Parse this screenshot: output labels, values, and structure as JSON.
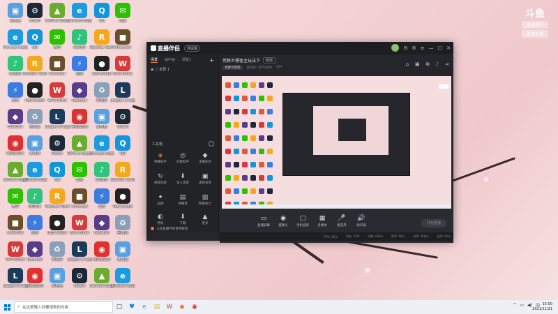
{
  "watermark": {
    "logo": "斗鱼",
    "line1": "直播伴侣",
    "line2": "录制工具"
  },
  "desktop_icons": [
    {
      "label": "此电脑",
      "color": "#5aa0e0",
      "glyph": "▣"
    },
    {
      "label": "Microsoft Edge",
      "color": "#1d9be0",
      "glyph": "e"
    },
    {
      "label": "QQ音乐",
      "color": "#31c27c",
      "glyph": "♪"
    },
    {
      "label": "迅雷",
      "color": "#3b7ce0",
      "glyph": "⚡"
    },
    {
      "label": "Obsidian",
      "color": "#5a3d8a",
      "glyph": "◆"
    },
    {
      "label": "网易云音乐",
      "color": "#e03030",
      "glyph": "◉"
    },
    {
      "label": "GeForce Experience",
      "color": "#6aad2e",
      "glyph": "▲"
    },
    {
      "label": "微信",
      "color": "#2dc100",
      "glyph": "✉"
    },
    {
      "label": "Minecraft",
      "color": "#6b4e2a",
      "glyph": "■"
    },
    {
      "label": "WPS Office",
      "color": "#d63a3a",
      "glyph": "W"
    },
    {
      "label": "League of Legends",
      "color": "#1c3a5a",
      "glyph": "L"
    },
    {
      "label": "Steam",
      "color": "#1b2838",
      "glyph": "⚙"
    },
    {
      "label": "QQ",
      "color": "#1296db",
      "glyph": "Q"
    },
    {
      "label": "Rockstar Games",
      "color": "#f6a81d",
      "glyph": "R"
    },
    {
      "label": "OBS Studio",
      "color": "#222222",
      "glyph": "●"
    },
    {
      "label": "回收站",
      "color": "#8aa0b8",
      "glyph": "♻"
    }
  ],
  "app": {
    "title": "直播伴侣",
    "version_tag": "测试版",
    "left_tabs": [
      "场景",
      "画中画",
      "场景1"
    ],
    "scene_item": "全屏 1",
    "tools_title": "工具箱",
    "tools": [
      {
        "icon": "◈",
        "label": "弹幕助手"
      },
      {
        "icon": "◎",
        "label": "房管助手"
      },
      {
        "icon": "◆",
        "label": "主播任务"
      },
      {
        "icon": "↻",
        "label": "视频连麦"
      },
      {
        "icon": "⬇",
        "label": "多人连麦"
      },
      {
        "icon": "▣",
        "label": "虚拟背景"
      },
      {
        "icon": "✦",
        "label": "美颜"
      },
      {
        "icon": "▤",
        "label": "弹幕墙"
      },
      {
        "icon": "▥",
        "label": "数据统计"
      },
      {
        "icon": "◐",
        "label": "特效"
      },
      {
        "icon": "⬇",
        "label": "下载"
      },
      {
        "icon": "▲",
        "label": "更多"
      }
    ],
    "footnote": "斗鱼直播伴侣使用教程",
    "room_title": "荒野大镖客主玩法下",
    "room_btn": "修改",
    "room_category": "荒野大镖客",
    "room_id": "房间号: 3072809",
    "room_viewers": "437",
    "controls": [
      {
        "icon": "▭",
        "label": "直播屏幕"
      },
      {
        "icon": "◉",
        "label": "摄像头"
      },
      {
        "icon": "▢",
        "label": "手机投屏"
      },
      {
        "icon": "▦",
        "label": "多媒体"
      },
      {
        "icon": "🎤",
        "label": "麦克风"
      },
      {
        "icon": "🔊",
        "label": "扬声器"
      }
    ],
    "go_live": "开始直播",
    "status": [
      "CPU: 25%",
      "内存: 33%",
      "网络: 0kb/s",
      "帧率: 0fps",
      "码率: 0kbps",
      "延时: 0ms"
    ]
  },
  "taskbar": {
    "search_placeholder": "在这里输入你要搜索的内容",
    "time": "15:50",
    "date": "2021/11/21",
    "lang": "中"
  }
}
